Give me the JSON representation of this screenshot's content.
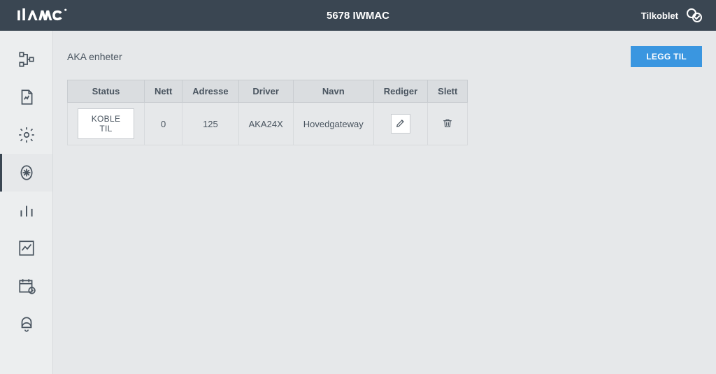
{
  "header": {
    "brand": "iwmac",
    "title": "5678 IWMAC",
    "status_label": "Tilkoblet"
  },
  "page": {
    "title": "AKA enheter",
    "add_button": "LEGG TIL"
  },
  "table": {
    "columns": {
      "status": "Status",
      "nett": "Nett",
      "adresse": "Adresse",
      "driver": "Driver",
      "navn": "Navn",
      "rediger": "Rediger",
      "slett": "Slett"
    },
    "rows": [
      {
        "status_action": "KOBLE TIL",
        "nett": "0",
        "adresse": "125",
        "driver": "AKA24X",
        "navn": "Hovedgateway"
      }
    ]
  }
}
